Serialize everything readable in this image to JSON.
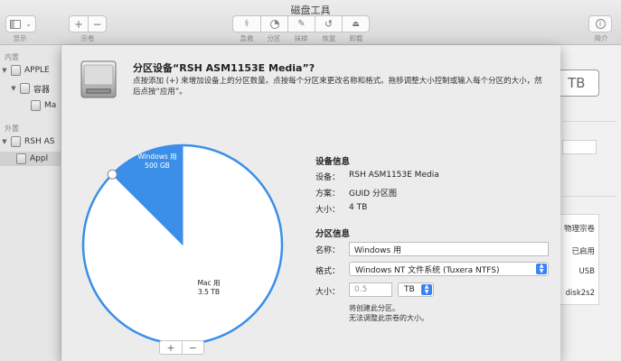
{
  "window": {
    "title": "磁盘工具"
  },
  "toolbar": {
    "show_label": "显示",
    "volume_label": "宗卷",
    "add_icon": "+",
    "remove_icon": "−",
    "first_aid_label": "急救",
    "partition_label": "分区",
    "erase_label": "抹掉",
    "restore_label": "恢复",
    "mount_label": "卸载",
    "info_label": "简介"
  },
  "sidebar": {
    "internal_header": "内置",
    "external_header": "外置",
    "items": [
      {
        "label": "APPLE"
      },
      {
        "label": "容器"
      },
      {
        "label": "Ma"
      },
      {
        "label": "RSH AS"
      },
      {
        "label": "Appl"
      }
    ]
  },
  "sheet": {
    "title": "分区设备“RSH ASM1153E Media”?",
    "description": "点按添加 (+) 来增加设备上的分区数量。点按每个分区来更改名称和格式。拖移调整大小控制或输入每个分区的大小，然后点按“应用”。",
    "pie": {
      "windows_name": "Windows 用",
      "windows_size": "500 GB",
      "mac_name": "Mac 用",
      "mac_size": "3.5 TB",
      "windows_color": "#3b8fe8",
      "mac_color": "#ffffff",
      "windows_fraction": 0.125
    },
    "add_button": "+",
    "remove_button": "−",
    "device_info": {
      "header": "设备信息",
      "device_key": "设备：",
      "device_value": "RSH ASM1153E Media",
      "scheme_key": "方案：",
      "scheme_value": "GUID 分区图",
      "size_key": "大小：",
      "size_value": "4 TB"
    },
    "partition_info": {
      "header": "分区信息",
      "name_key": "名称：",
      "name_value": "Windows 用",
      "format_key": "格式：",
      "format_value": "Windows NT 文件系统 (Tuxera NTFS)",
      "size_key": "大小：",
      "size_value": "0.5",
      "size_unit": "TB",
      "note_line1": "将创建此分区。",
      "note_line2": "无法调整此宗卷的大小。"
    }
  },
  "right_panel": {
    "button_text": "TB",
    "cells": [
      "物理宗卷",
      "已启用",
      "USB",
      "disk2s2"
    ]
  },
  "colors": {
    "accent": "#3b82f6"
  }
}
